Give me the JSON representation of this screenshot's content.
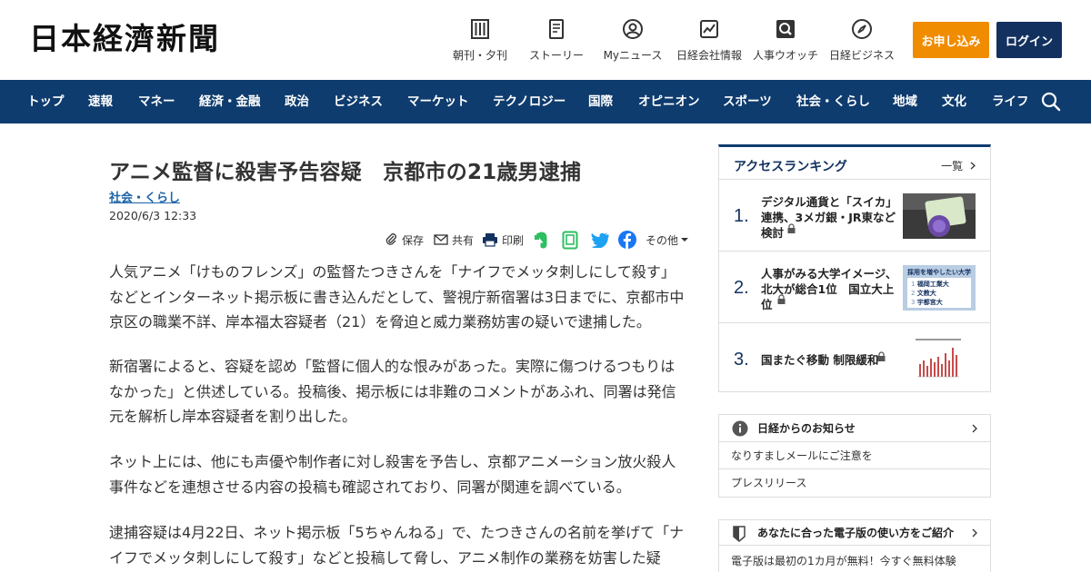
{
  "header": {
    "logo": "日本経濟新聞",
    "services": [
      {
        "label": "朝刊・夕刊",
        "icon": "newspaper-icon"
      },
      {
        "label": "ストーリー",
        "icon": "book-icon"
      },
      {
        "label": "Myニュース",
        "icon": "user-icon"
      },
      {
        "label": "日経会社情報",
        "icon": "chart-icon"
      },
      {
        "label": "人事ウオッチ",
        "icon": "magnifier-icon"
      },
      {
        "label": "日経ビジネス",
        "icon": "compass-icon"
      }
    ],
    "apply_label": "お申し込み",
    "login_label": "ログイン"
  },
  "nav": {
    "items": [
      "トップ",
      "速報",
      "マネー",
      "経済・金融",
      "政治",
      "ビジネス",
      "マーケット",
      "テクノロジー",
      "国際",
      "オピニオン",
      "スポーツ",
      "社会・くらし",
      "地域",
      "文化",
      "ライフ"
    ]
  },
  "article": {
    "title": "アニメ監督に殺害予告容疑　京都市の21歳男逮捕",
    "category": "社会・くらし",
    "date": "2020/6/3 12:33",
    "tools": {
      "save": "保存",
      "share": "共有",
      "print": "印刷",
      "more": "その他"
    },
    "paragraphs": [
      "人気アニメ「けものフレンズ」の監督たつきさんを「ナイフでメッタ刺しにして殺す」などとインターネット掲示板に書き込んだとして、警視庁新宿署は3日までに、京都市中京区の職業不詳、岸本福太容疑者（21）を脅迫と威力業務妨害の疑いで逮捕した。",
      "新宿署によると、容疑を認め「監督に個人的な恨みがあった。実際に傷つけるつもりはなかった」と供述している。投稿後、掲示板には非難のコメントがあふれ、同署は発信元を解析し岸本容疑者を割り出した。",
      "ネット上には、他にも声優や制作者に対し殺害を予告し、京都アニメーション放火殺人事件などを連想させる内容の投稿も確認されており、同署が関連を調べている。",
      "逮捕容疑は4月22日、ネット掲示板「5ちゃんねる」で、たつきさんの名前を挙げて「ナイフでメッタ刺しにして殺す」などと投稿して脅し、アニメ制作の業務を妨害した疑"
    ]
  },
  "ranking": {
    "title": "アクセスランキング",
    "all_label": "一覧",
    "items": [
      {
        "num": "1.",
        "text": "デジタル通貨と「スイカ」連携、3メガ銀・JR東など検討"
      },
      {
        "num": "2.",
        "text": "人事がみる大学イメージ、北大が総合1位　国立大上位"
      },
      {
        "num": "3.",
        "text": "国またぐ移動 制限緩和"
      }
    ],
    "thumb2": {
      "heading": "採用を増やしたい大学",
      "rows": [
        {
          "rank": "1",
          "name": "福岡工業大"
        },
        {
          "rank": "2",
          "name": "文教大"
        },
        {
          "rank": "3",
          "name": "宇都宮大"
        }
      ]
    }
  },
  "notice": {
    "title": "日経からのお知らせ",
    "items": [
      "なりすましメールにご注意を",
      "プレスリリース"
    ]
  },
  "guide": {
    "title": "あなたに合った電子版の使い方をご紹介",
    "subtitle": "電子版は最初の1カ月が無料！今すぐ無料体験"
  },
  "colors": {
    "nav_bg": "#0f3c6e",
    "apply_bg": "#f08c00",
    "login_bg": "#13315f",
    "link": "#1a63a8"
  }
}
